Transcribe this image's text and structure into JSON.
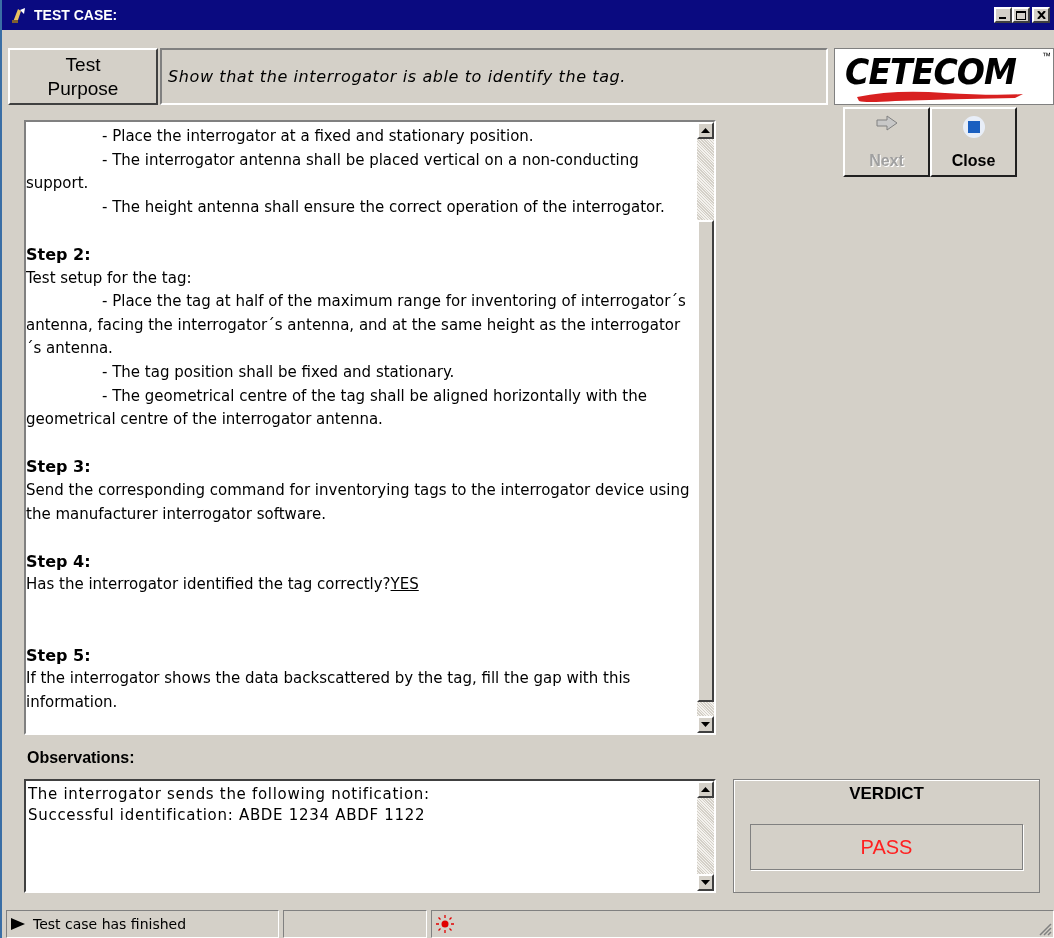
{
  "window": {
    "title": "TEST CASE:"
  },
  "purpose": {
    "label": "Test Purpose",
    "text": "Show that the interrogator is able to identify the tag."
  },
  "logo": {
    "text": "CETECOM",
    "mark": "™"
  },
  "steps": [
    {
      "kind": "indented",
      "text": "- Place the interrogator at a fixed and stationary position."
    },
    {
      "kind": "indented",
      "text": "- The interrogator antenna shall be placed vertical on a non-conducting support."
    },
    {
      "kind": "indented",
      "text": "- The height antenna shall ensure the correct operation of the interrogator."
    },
    {
      "kind": "heading",
      "text": "Step 2:"
    },
    {
      "kind": "plain",
      "text": "Test setup for the tag:"
    },
    {
      "kind": "indented",
      "text": "- Place the tag at half of the maximum range for inventoring of interrogator´s antenna, facing the interrogator´s antenna, and at the same height as the interrogator´s antenna."
    },
    {
      "kind": "indented",
      "text": "- The tag position shall be fixed and stationary."
    },
    {
      "kind": "indented",
      "text": "- The geometrical centre of the tag shall be aligned horizontally with the geometrical centre of the interrogator antenna."
    },
    {
      "kind": "heading",
      "text": "Step 3:"
    },
    {
      "kind": "plain",
      "text": "Send the corresponding command for inventorying tags to the interrogator device using the manufacturer interrogator software."
    },
    {
      "kind": "heading",
      "text": "Step 4:"
    },
    {
      "kind": "question",
      "text": "Has the interrogator identified the tag correctly?",
      "answer": "YES"
    },
    {
      "kind": "heading",
      "text": "Step 5:"
    },
    {
      "kind": "plain",
      "text": "If the interrogator shows the data backscattered by the tag, fill the gap with this information."
    }
  ],
  "buttons": [
    {
      "label": "Next",
      "kind": "next",
      "disabled": true
    },
    {
      "label": "Close",
      "kind": "close",
      "disabled": false
    }
  ],
  "observations": {
    "label": "Observations:",
    "value": "The interrogator sends the following notification:\nSuccessful identification: ABDE 1234 ABDF 1122"
  },
  "verdict": {
    "label": "VERDICT",
    "value": "PASS"
  },
  "status_bar": {
    "message": "Test case has finished"
  }
}
